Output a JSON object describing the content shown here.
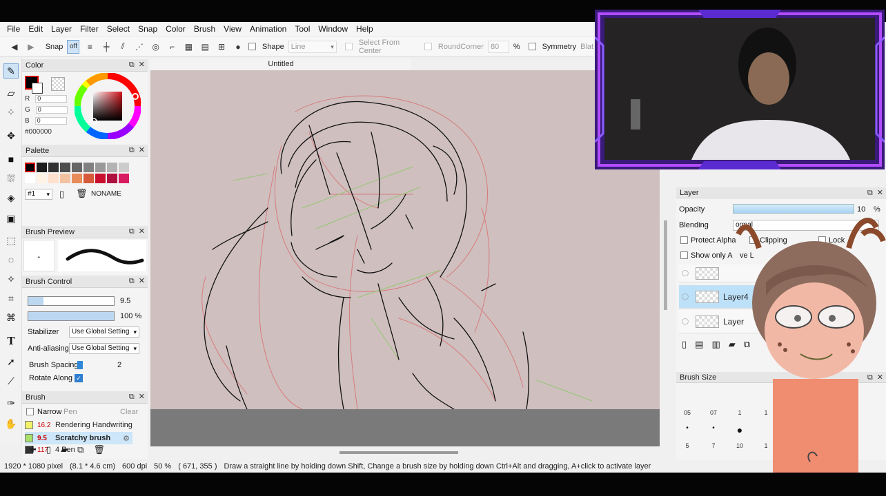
{
  "menu": [
    "File",
    "Edit",
    "Layer",
    "Filter",
    "Select",
    "Snap",
    "Color",
    "Brush",
    "View",
    "Animation",
    "Tool",
    "Window",
    "Help"
  ],
  "toolbar": {
    "snap_label": "Snap",
    "off_label": "off",
    "shape_label": "Shape",
    "shape_value": "Line",
    "select_from_center": "Select From Center",
    "roundcorner": "RoundCorner",
    "roundcorner_value": "80",
    "percent": "%",
    "symmetry": "Symmetry",
    "blat": "Blat"
  },
  "canvas": {
    "tab_title": "Untitled"
  },
  "color_panel": {
    "title": "Color",
    "r_label": "R",
    "r_value": "0",
    "g_label": "G",
    "g_value": "0",
    "b_label": "B",
    "b_value": "0",
    "hex": "#000000",
    "fg_color": "#000000"
  },
  "palette_panel": {
    "title": "Palette",
    "colors": [
      "#000000",
      "#1c1c1c",
      "#333333",
      "#4d4d4d",
      "#666666",
      "#808080",
      "#999999",
      "#b3b3b3",
      "#cccccc",
      "#ffffff",
      "#fff3e6",
      "#ffe0cc",
      "#f2c2a0",
      "#e88c5a",
      "#d65a3a",
      "#c8102e",
      "#b01040",
      "#d81b60"
    ],
    "palette_index": "#1",
    "palette_name": "NONAME"
  },
  "brush_preview": {
    "title": "Brush Preview"
  },
  "brush_control": {
    "title": "Brush Control",
    "size_value": "9.5",
    "opacity_value": "100 %",
    "stabilizer_label": "Stabilizer",
    "stabilizer_value": "Use Global Setting",
    "antialias_label": "Anti-aliasing",
    "antialias_value": "Use Global Setting",
    "spacing_label": "Brush Spacing",
    "spacing_value": "2",
    "rotate_label": "Rotate Along"
  },
  "brush_panel": {
    "title": "Brush",
    "narrow_label": "Narrow",
    "filter_placeholder": "Pen",
    "clear_label": "Clear",
    "items": [
      {
        "size": "16.2",
        "name": "Rendering Handwriting",
        "color": "#f3f36a"
      },
      {
        "size": "9.5",
        "name": "Scratchy brush",
        "color": "#a8e06a"
      },
      {
        "size": "117",
        "name": "4 Pen",
        "color": "#333333"
      }
    ]
  },
  "layer_panel": {
    "title": "Layer",
    "opacity_label": "Opacity",
    "opacity_value": "10",
    "opacity_unit": "%",
    "blending_label": "Blending",
    "blending_value": "ormal",
    "protect_alpha": "Protect Alpha",
    "clipping": "Clipping",
    "lock": "Lock",
    "show_only_active": "Show only A",
    "show_only_active_tail": "ve L",
    "layers": [
      "",
      "Layer4",
      "Layer"
    ]
  },
  "brush_size_panel": {
    "title": "Brush Size",
    "sizes_row1": [
      "05",
      "07",
      "1",
      "1"
    ],
    "sizes_row2": [
      "5",
      "7",
      "10",
      "1"
    ]
  },
  "status": {
    "pixels": "1920 * 1080 pixel",
    "cm": "(8.1 * 4.6 cm)",
    "dpi": "600 dpi",
    "zoom": "50 %",
    "coords": "( 671, 355 )",
    "hint": "Draw a straight line by holding down Shift, Change a brush size by holding down Ctrl+Alt and dragging, A+click to activate layer"
  }
}
